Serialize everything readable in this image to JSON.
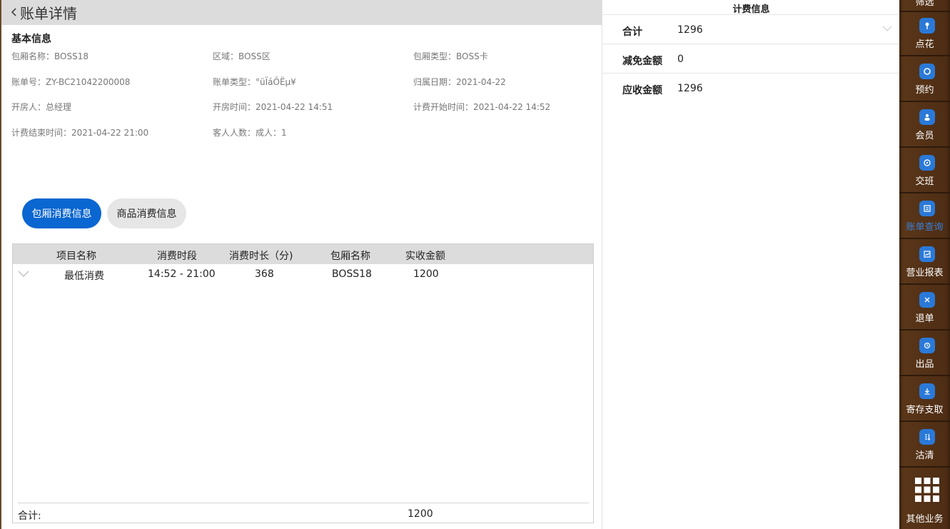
{
  "header": {
    "title": "账单详情"
  },
  "basic_info": {
    "section_title": "基本信息",
    "fields": [
      "包厢名称：BOSS18",
      "区域：BOSS区",
      "包厢类型：BOSS卡",
      "账单号：ZY-BC21042200008",
      "账单类型：°üÏáÕËµ¥",
      "归属日期：2021-04-22",
      "开房人：总经理",
      "开房时间：2021-04-22 14:51",
      "计费开始时间：2021-04-22 14:52",
      "计费结束时间：2021-04-22 21:00",
      "客人人数：成人：1"
    ]
  },
  "tabs": [
    {
      "label": "包厢消费信息",
      "active": true
    },
    {
      "label": "商品消费信息",
      "active": false
    }
  ],
  "table": {
    "headers": [
      "项目名称",
      "消费时段",
      "消费时长（分)",
      "包厢名称",
      "实收金额"
    ],
    "rows": [
      {
        "item": "最低消费",
        "period": "14:52 - 21:00",
        "duration": "368",
        "room": "BOSS18",
        "amount": "1200"
      }
    ],
    "footer_label": "合计:",
    "footer_amount": "1200"
  },
  "fee_info": {
    "title": "计费信息",
    "rows": [
      {
        "label": "合计",
        "value": "1296"
      },
      {
        "label": "减免金额",
        "value": "0"
      },
      {
        "label": "应收金额",
        "value": "1296"
      }
    ]
  },
  "sidebar": {
    "top_partial_label": "筛选",
    "items": [
      {
        "label": "点花",
        "icon": "flower-icon"
      },
      {
        "label": "预约",
        "icon": "reserve-icon"
      },
      {
        "label": "会员",
        "icon": "member-icon"
      },
      {
        "label": "交班",
        "icon": "shift-icon"
      },
      {
        "label": "账单查询",
        "icon": "bill-query-icon",
        "active": true
      },
      {
        "label": "营业报表",
        "icon": "report-icon"
      },
      {
        "label": "退单",
        "icon": "refund-icon"
      },
      {
        "label": "出品",
        "icon": "dispatch-icon"
      },
      {
        "label": "寄存支取",
        "icon": "storage-icon"
      },
      {
        "label": "沽清",
        "icon": "clear-icon"
      }
    ],
    "more_label": "其他业务"
  },
  "colors": {
    "accent": "#0a66d1",
    "sidebar_bg": "#4d2d14",
    "header_bg": "#dcdcdc"
  }
}
